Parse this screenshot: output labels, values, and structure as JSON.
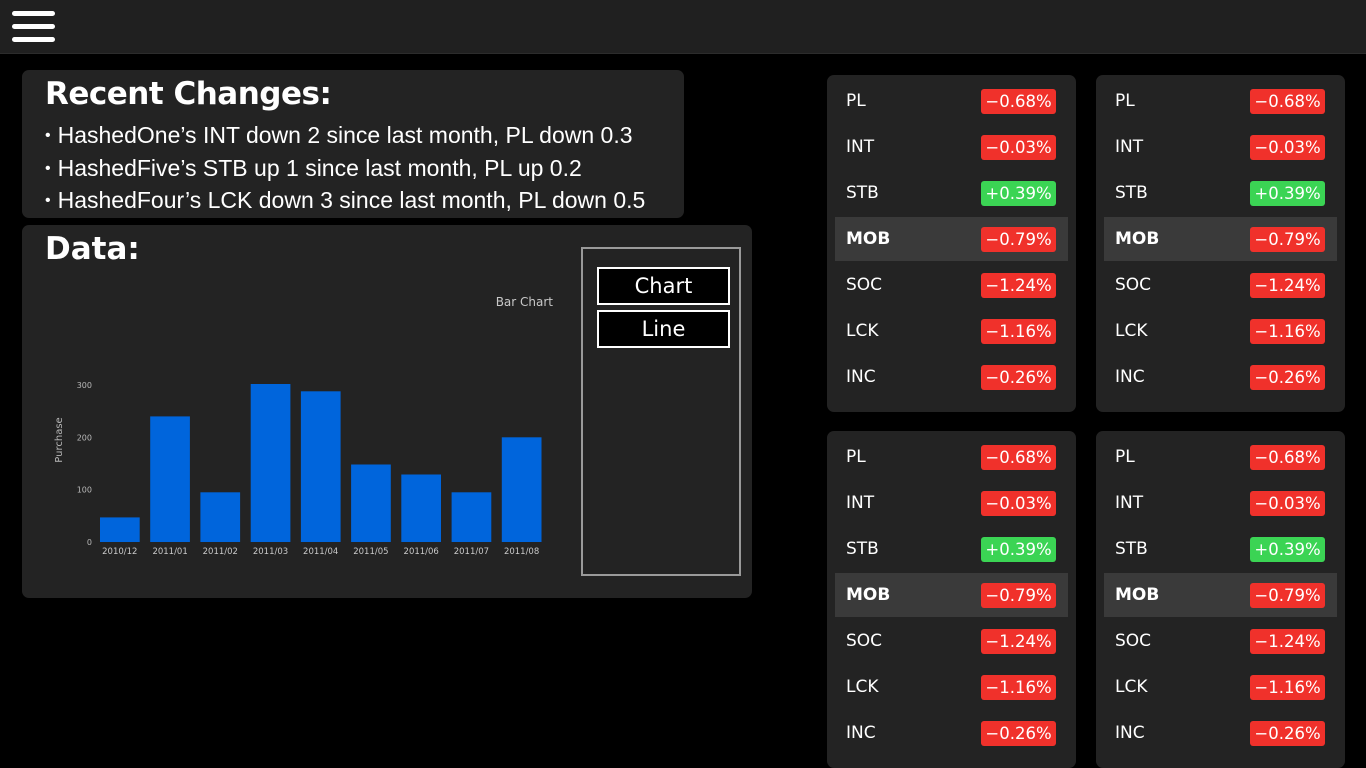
{
  "menu": {
    "icon": "hamburger-menu-icon"
  },
  "recent": {
    "title": "Recent Changes:",
    "items": [
      "HashedOne’s INT down 2 since last month, PL down 0.3",
      "HashedFive’s STB up 1 since last month, PL up 0.2",
      "HashedFour’s LCK down 3 since last month, PL down 0.5"
    ]
  },
  "data_panel": {
    "title": "Data:",
    "buttons": {
      "chart": "Chart",
      "line": "Line"
    }
  },
  "chart_data": {
    "type": "bar",
    "title": "Bar Chart",
    "ylabel": "Purchase",
    "xlabel": "",
    "categories": [
      "2010/12",
      "2011/01",
      "2011/02",
      "2011/03",
      "2011/04",
      "2011/05",
      "2011/06",
      "2011/07",
      "2011/08"
    ],
    "values": [
      47,
      240,
      95,
      302,
      288,
      148,
      129,
      95,
      200
    ],
    "yticks": [
      0,
      100,
      200,
      300
    ],
    "ylim": [
      0,
      300
    ],
    "grid": false,
    "bar_color": "#0065dc"
  },
  "colors": {
    "down": "#f0312b",
    "up": "#3bd454",
    "highlight_row": "#3a3a3a"
  },
  "cards": [
    {
      "rows": [
        {
          "label": "PL",
          "change": "−0.68%",
          "direction": "down"
        },
        {
          "label": "INT",
          "change": "−0.03%",
          "direction": "down"
        },
        {
          "label": "STB",
          "change": "+0.39%",
          "direction": "up"
        },
        {
          "label": "MOB",
          "change": "−0.79%",
          "direction": "down",
          "highlighted": true
        },
        {
          "label": "SOC",
          "change": "−1.24%",
          "direction": "down"
        },
        {
          "label": "LCK",
          "change": "−1.16%",
          "direction": "down"
        },
        {
          "label": "INC",
          "change": "−0.26%",
          "direction": "down"
        }
      ]
    },
    {
      "rows": [
        {
          "label": "PL",
          "change": "−0.68%",
          "direction": "down"
        },
        {
          "label": "INT",
          "change": "−0.03%",
          "direction": "down"
        },
        {
          "label": "STB",
          "change": "+0.39%",
          "direction": "up"
        },
        {
          "label": "MOB",
          "change": "−0.79%",
          "direction": "down",
          "highlighted": true
        },
        {
          "label": "SOC",
          "change": "−1.24%",
          "direction": "down"
        },
        {
          "label": "LCK",
          "change": "−1.16%",
          "direction": "down"
        },
        {
          "label": "INC",
          "change": "−0.26%",
          "direction": "down"
        }
      ]
    },
    {
      "rows": [
        {
          "label": "PL",
          "change": "−0.68%",
          "direction": "down"
        },
        {
          "label": "INT",
          "change": "−0.03%",
          "direction": "down"
        },
        {
          "label": "STB",
          "change": "+0.39%",
          "direction": "up"
        },
        {
          "label": "MOB",
          "change": "−0.79%",
          "direction": "down",
          "highlighted": true
        },
        {
          "label": "SOC",
          "change": "−1.24%",
          "direction": "down"
        },
        {
          "label": "LCK",
          "change": "−1.16%",
          "direction": "down"
        },
        {
          "label": "INC",
          "change": "−0.26%",
          "direction": "down"
        }
      ]
    },
    {
      "rows": [
        {
          "label": "PL",
          "change": "−0.68%",
          "direction": "down"
        },
        {
          "label": "INT",
          "change": "−0.03%",
          "direction": "down"
        },
        {
          "label": "STB",
          "change": "+0.39%",
          "direction": "up"
        },
        {
          "label": "MOB",
          "change": "−0.79%",
          "direction": "down",
          "highlighted": true
        },
        {
          "label": "SOC",
          "change": "−1.24%",
          "direction": "down"
        },
        {
          "label": "LCK",
          "change": "−1.16%",
          "direction": "down"
        },
        {
          "label": "INC",
          "change": "−0.26%",
          "direction": "down"
        }
      ]
    }
  ]
}
